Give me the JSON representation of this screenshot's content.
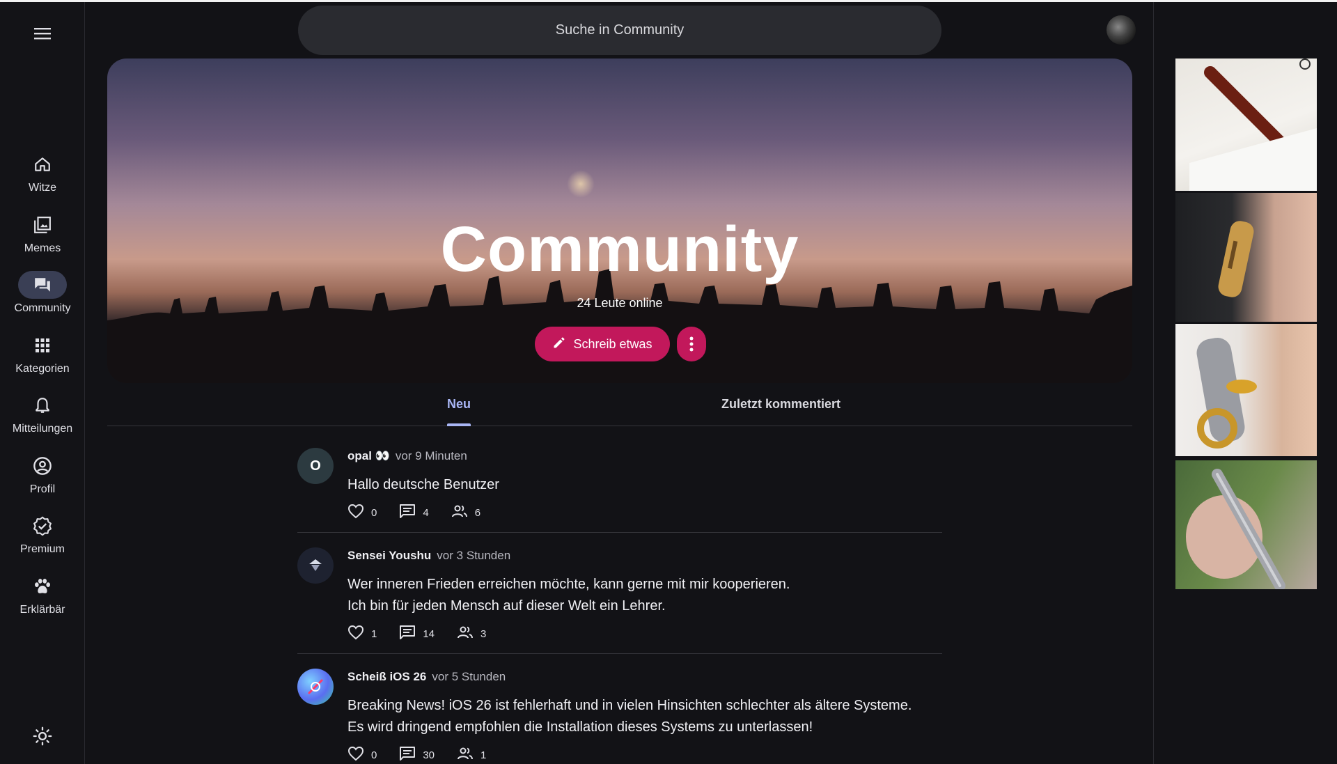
{
  "search": {
    "placeholder": "Suche in Community"
  },
  "sidebar": {
    "items": [
      {
        "label": "Witze",
        "icon": "home-icon"
      },
      {
        "label": "Memes",
        "icon": "image-gallery-icon"
      },
      {
        "label": "Community",
        "icon": "forum-icon",
        "active": true
      },
      {
        "label": "Kategorien",
        "icon": "grid-icon"
      },
      {
        "label": "Mitteilungen",
        "icon": "bell-icon"
      },
      {
        "label": "Profil",
        "icon": "account-circle-icon"
      },
      {
        "label": "Premium",
        "icon": "verified-badge-icon"
      },
      {
        "label": "Erklärbär",
        "icon": "paw-icon"
      }
    ]
  },
  "hero": {
    "title": "Community",
    "online": "24 Leute online",
    "write_label": "Schreib etwas"
  },
  "tabs": {
    "new": "Neu",
    "recent": "Zuletzt kommentiert"
  },
  "posts": [
    {
      "avatar_letter": "O",
      "author": "opal 👀",
      "time": "vor 9 Minuten",
      "lines": [
        "Hallo deutsche Benutzer"
      ],
      "likes": "0",
      "comments": "4",
      "participants": "6"
    },
    {
      "avatar_letter": "",
      "author": "Sensei Youshu",
      "time": "vor 3 Stunden",
      "lines": [
        "Wer inneren Frieden erreichen möchte, kann gerne mit mir kooperieren.",
        "Ich bin für jeden Mensch auf dieser Welt ein Lehrer."
      ],
      "likes": "1",
      "comments": "14",
      "participants": "3"
    },
    {
      "avatar_letter": "",
      "author": "Scheiß iOS 26",
      "time": "vor 5 Stunden",
      "lines": [
        "Breaking News! iOS 26 ist fehlerhaft und in vielen Hinsichten schlechter als ältere Systeme.",
        "Es wird dringend empfohlen die Installation dieses Systems zu unterlassen!"
      ],
      "likes": "0",
      "comments": "30",
      "participants": "1"
    }
  ],
  "colors": {
    "accent": "#c2185b",
    "tab_active": "#a9b6f5",
    "background": "#121216"
  }
}
